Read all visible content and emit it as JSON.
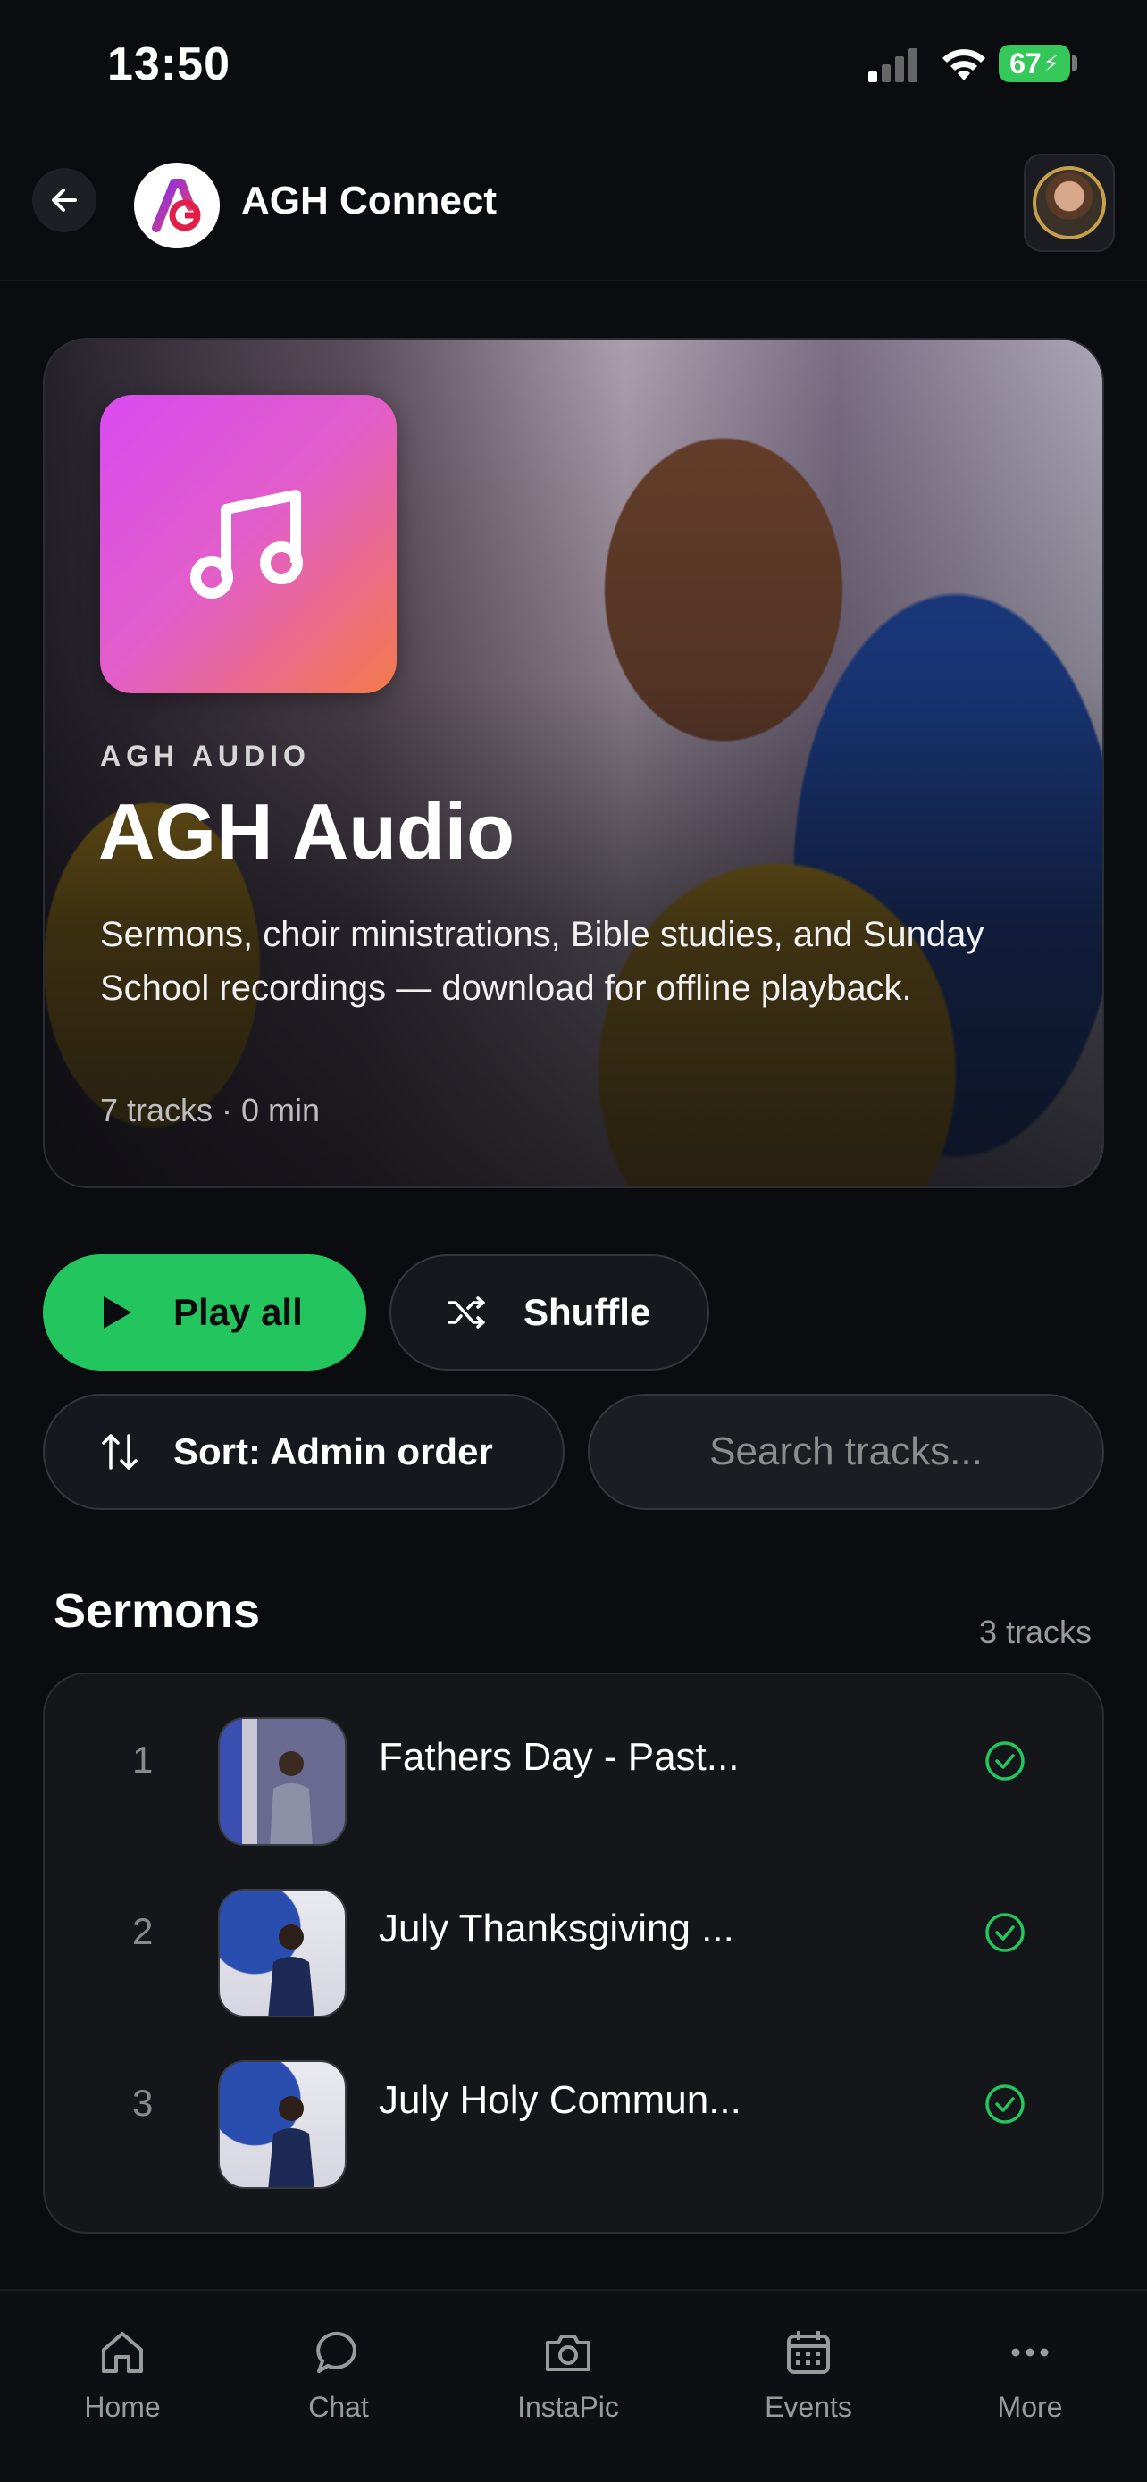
{
  "status_bar": {
    "time": "13:50",
    "battery": "67"
  },
  "header": {
    "app_title": "AGH Connect"
  },
  "hero": {
    "kicker": "AGH AUDIO",
    "title": "AGH Audio",
    "description": "Sermons, choir ministrations, Bible studies, and Sunday School recordings — download for offline playback.",
    "meta": "7 tracks · 0 min"
  },
  "actions": {
    "play_all": "Play all",
    "shuffle": "Shuffle",
    "sort": "Sort: Admin order",
    "search_placeholder": "Search tracks..."
  },
  "section": {
    "title": "Sermons",
    "count": "3 tracks",
    "tracks": [
      {
        "num": "1",
        "title": "Fathers Day - Past..."
      },
      {
        "num": "2",
        "title": "July Thanksgiving ..."
      },
      {
        "num": "3",
        "title": "July Holy Commun..."
      }
    ]
  },
  "tabbar": {
    "items": [
      {
        "label": "Home",
        "icon": "home-icon"
      },
      {
        "label": "Chat",
        "icon": "chat-icon"
      },
      {
        "label": "InstaPic",
        "icon": "camera-icon"
      },
      {
        "label": "Events",
        "icon": "calendar-icon"
      },
      {
        "label": "More",
        "icon": "more-icon"
      }
    ]
  },
  "colors": {
    "accent": "#22c55e",
    "background": "#0b0c10",
    "hero_art_start": "#d94af0",
    "hero_art_end": "#f47a4a"
  }
}
